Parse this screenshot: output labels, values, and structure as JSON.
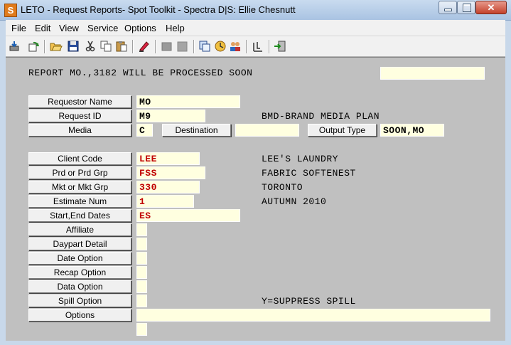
{
  "window": {
    "title": "LETO - Request Reports- Spot Toolkit - Spectra D|S: Ellie Chesnutt",
    "app_icon_letter": "S"
  },
  "menu": [
    "File",
    "Edit",
    "View",
    "Service",
    "Options",
    "Help"
  ],
  "toolbar_icons": [
    "print-icon",
    "refresh-icon",
    "open-folder-icon",
    "save-icon",
    "cut-icon",
    "copy-icon",
    "paste-icon",
    "clear-icon",
    "stop-icon",
    "stop-disabled-icon",
    "copy-doc-icon",
    "history-icon",
    "users-icon",
    "run-icon",
    "exit-icon"
  ],
  "message": "REPORT MO.,3182 WILL BE PROCESSED SOON",
  "message_box": "",
  "fields": {
    "requestor_name": {
      "label": "Requestor Name",
      "value": "MO"
    },
    "request_id": {
      "label": "Request ID",
      "value": "M9"
    },
    "media": {
      "label": "Media",
      "value": "C"
    },
    "destination": {
      "label": "Destination",
      "value": ""
    },
    "output_type": {
      "label": "Output Type",
      "value": "SOON,MO"
    },
    "client_code": {
      "label": "Client Code",
      "value": "LEE"
    },
    "prd": {
      "label": "Prd or Prd Grp",
      "value": "FSS"
    },
    "mkt": {
      "label": "Mkt or Mkt Grp",
      "value": "330"
    },
    "estimate": {
      "label": "Estimate Num",
      "value": "1"
    },
    "dates": {
      "label": "Start,End Dates",
      "value": "ES"
    },
    "affiliate": {
      "label": "Affiliate",
      "value": ""
    },
    "daypart": {
      "label": "Daypart Detail",
      "value": ""
    },
    "date_option": {
      "label": "Date Option",
      "value": ""
    },
    "recap_option": {
      "label": "Recap Option",
      "value": ""
    },
    "data_option": {
      "label": "Data Option",
      "value": ""
    },
    "spill_option": {
      "label": "Spill Option",
      "value": ""
    },
    "options": {
      "label": "Options",
      "value": ""
    },
    "extra": {
      "value": ""
    }
  },
  "info": {
    "request_desc": "BMD-BRAND MEDIA PLAN",
    "client_name": "LEE'S LAUNDRY",
    "product_name": "FABRIC SOFTENEST",
    "market_name": "TORONTO",
    "estimate_name": "AUTUMN 2010",
    "spill_note": "Y=SUPPRESS SPILL"
  },
  "colors": {
    "field_bg": "#ffffe0",
    "value_red": "#c00000",
    "panel": "#c0c0c0"
  }
}
